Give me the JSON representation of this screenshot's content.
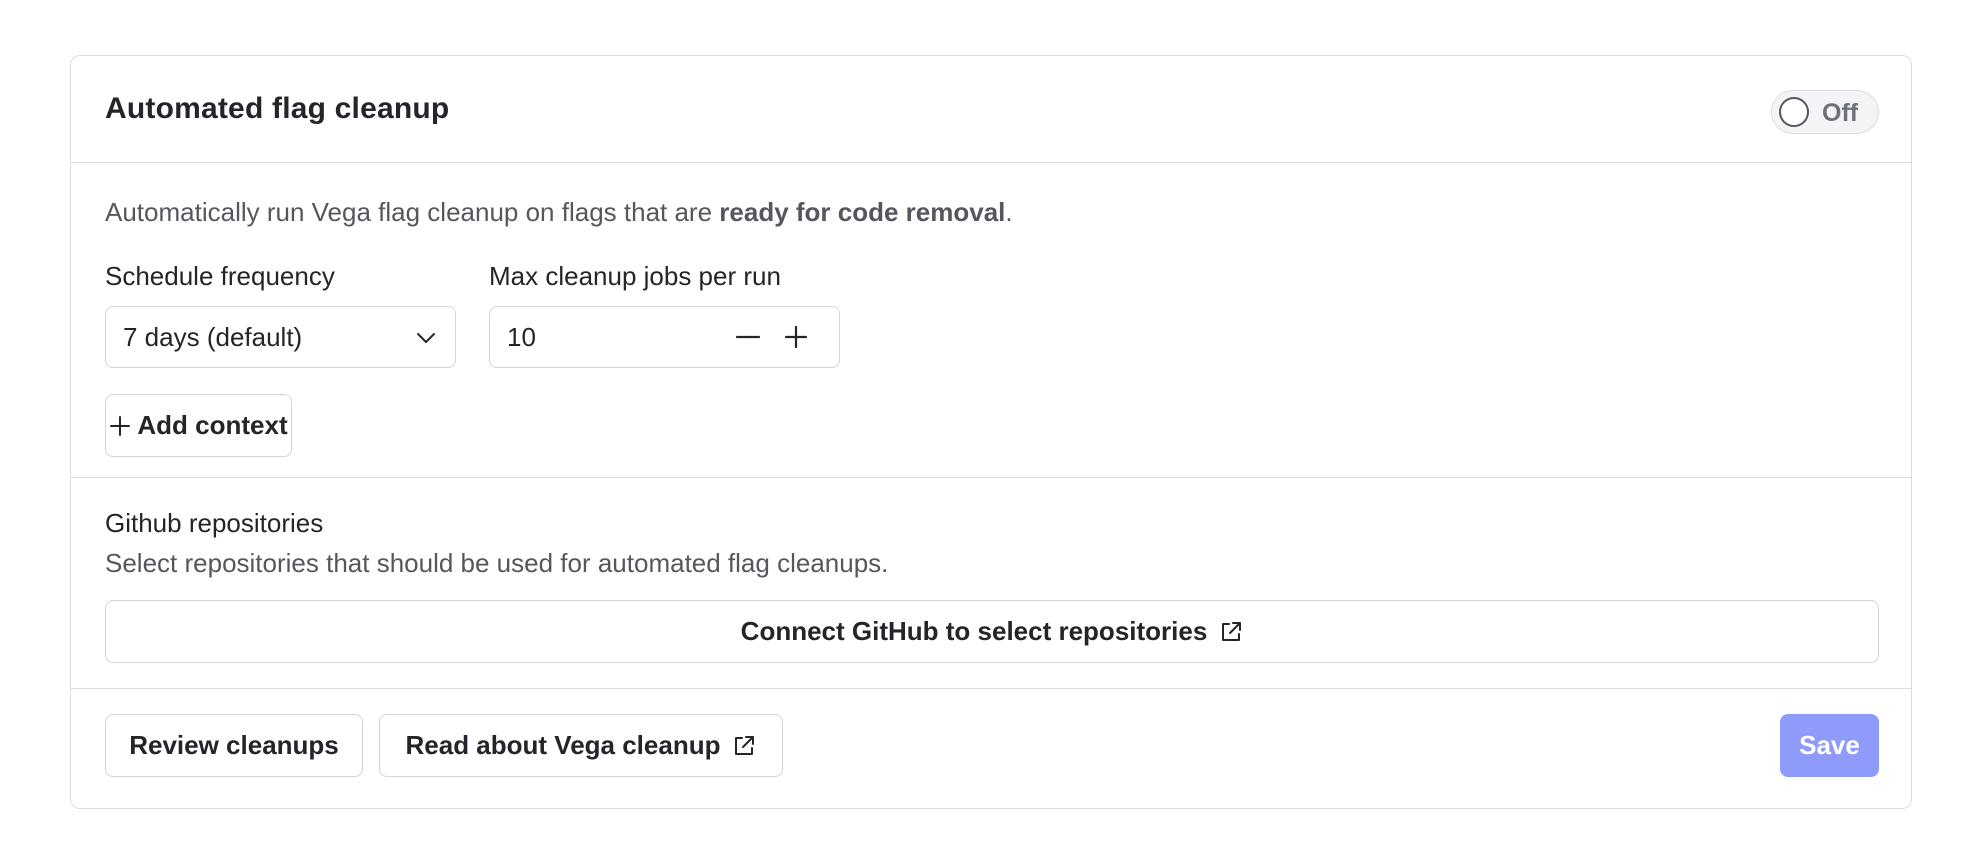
{
  "card": {
    "title": "Automated flag cleanup",
    "toggle": {
      "label": "Off",
      "state": "off"
    }
  },
  "settings": {
    "description_prefix": "Automatically run Vega flag cleanup on flags that are ",
    "description_bold": "ready for code removal",
    "description_suffix": ".",
    "schedule_label": "Schedule frequency",
    "schedule_value": "7 days (default)",
    "max_jobs_label": "Max cleanup jobs per run",
    "max_jobs_value": "10",
    "add_context_label": "Add context"
  },
  "github": {
    "title": "Github repositories",
    "description": "Select repositories that should be used for automated flag cleanups.",
    "connect_label": "Connect GitHub to select repositories"
  },
  "footer": {
    "review_label": "Review cleanups",
    "read_label": "Read about Vega cleanup",
    "save_label": "Save"
  },
  "colors": {
    "accent": "#8f9bfb",
    "border": "#dcdde2",
    "text": "#23252b",
    "muted": "#55575f"
  },
  "icons": [
    "chevron-down-icon",
    "minus-icon",
    "plus-icon",
    "external-link-icon"
  ]
}
